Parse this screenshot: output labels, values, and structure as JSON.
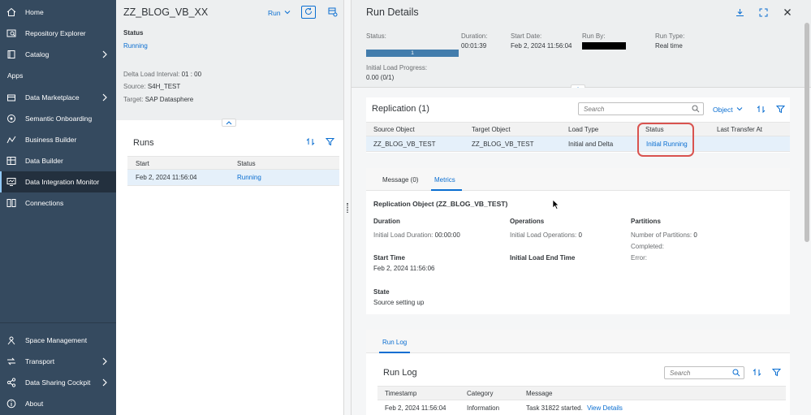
{
  "sidebar": {
    "items_top": [
      {
        "label": "Home",
        "icon": "home-icon"
      },
      {
        "label": "Repository Explorer",
        "icon": "repository-icon"
      },
      {
        "label": "Catalog",
        "icon": "catalog-icon",
        "chevron": true
      }
    ],
    "section_label": "Apps",
    "items_apps": [
      {
        "label": "Data Marketplace",
        "icon": "marketplace-icon",
        "chevron": true
      },
      {
        "label": "Semantic Onboarding",
        "icon": "onboarding-icon"
      },
      {
        "label": "Business Builder",
        "icon": "business-builder-icon"
      },
      {
        "label": "Data Builder",
        "icon": "data-builder-icon"
      },
      {
        "label": "Data Integration Monitor",
        "icon": "monitor-icon",
        "active": true
      },
      {
        "label": "Connections",
        "icon": "connections-icon"
      }
    ],
    "items_bottom": [
      {
        "label": "Space Management",
        "icon": "space-icon"
      },
      {
        "label": "Transport",
        "icon": "transport-icon",
        "chevron": true
      },
      {
        "label": "Data Sharing Cockpit",
        "icon": "share-icon",
        "chevron": true
      },
      {
        "label": "About",
        "icon": "info-icon"
      }
    ]
  },
  "left": {
    "title": "ZZ_BLOG_VB_XX",
    "run_label": "Run",
    "status_label": "Status",
    "status_value": "Running",
    "delta_label": "Delta Load Interval:",
    "delta_value": "01 : 00",
    "source_label": "Source:",
    "source_value": "S4H_TEST",
    "target_label": "Target:",
    "target_value": "SAP Datasphere",
    "runs_title": "Runs",
    "runs_columns": [
      "Start",
      "Status"
    ],
    "runs_rows": [
      {
        "start": "Feb 2, 2024 11:56:04",
        "status": "Running"
      }
    ]
  },
  "run_details": {
    "title": "Run Details",
    "status_label": "Status:",
    "progress_value": "1",
    "progress_fraction": 1.0,
    "duration_label": "Duration:",
    "duration_value": "00:01:39",
    "start_date_label": "Start Date:",
    "start_date_value": "Feb 2, 2024 11:56:04",
    "run_by_label": "Run By:",
    "run_type_label": "Run Type:",
    "run_type_value": "Real time",
    "initial_load_label": "Initial Load Progress:",
    "initial_load_value": "0.00 (0/1)"
  },
  "replication": {
    "title": "Replication (1)",
    "search_placeholder": "Search",
    "object_dropdown": "Object",
    "columns": [
      "Source Object",
      "Target Object",
      "Load Type",
      "Status",
      "Last Transfer At"
    ],
    "rows": [
      {
        "source": "ZZ_BLOG_VB_TEST",
        "target": "ZZ_BLOG_VB_TEST",
        "load_type": "Initial and Delta",
        "status": "Initial Running",
        "last_transfer": ""
      }
    ]
  },
  "metrics": {
    "tabs": [
      "Message (0)",
      "Metrics"
    ],
    "active_tab": "Metrics",
    "object_title": "Replication Object (ZZ_BLOG_VB_TEST)",
    "duration_heading": "Duration",
    "initial_load_duration_label": "Initial Load Duration:",
    "initial_load_duration_value": "00:00:00",
    "operations_heading": "Operations",
    "initial_load_operations_label": "Initial Load Operations:",
    "initial_load_operations_value": "0",
    "partitions_heading": "Partitions",
    "number_partitions_label": "Number of Partitions:",
    "number_partitions_value": "0",
    "completed_label": "Completed:",
    "error_label": "Error:",
    "start_time_heading": "Start Time",
    "start_time_value": "Feb 2, 2024 11:56:06",
    "end_time_heading": "Initial Load End Time",
    "state_heading": "State",
    "state_value": "Source setting up"
  },
  "run_log": {
    "tab": "Run Log",
    "title": "Run Log",
    "search_placeholder": "Search",
    "columns": [
      "Timestamp",
      "Category",
      "Message"
    ],
    "rows": [
      {
        "timestamp": "Feb 2, 2024 11:56:04",
        "category": "Information",
        "message": "Task 31822 started.",
        "link": "View Details"
      }
    ]
  },
  "colors": {
    "sidebar_bg": "#354a5f",
    "accent": "#0a6ed1",
    "highlight": "#d9534f"
  }
}
